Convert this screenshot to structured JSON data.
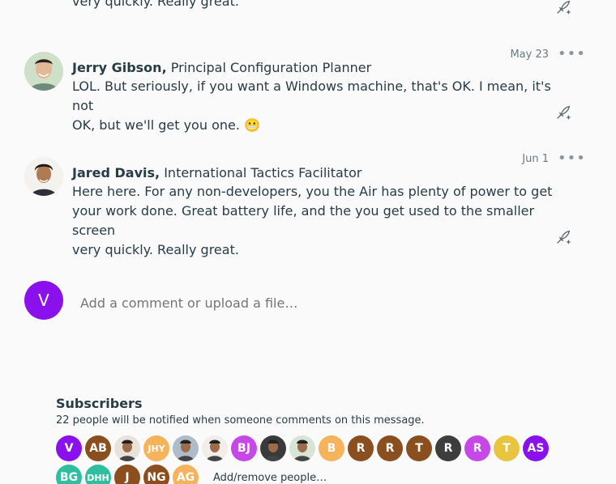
{
  "top_fragment": {
    "text": "very quickly. Really great."
  },
  "comments": [
    {
      "author": "Jerry Gibson,",
      "title": "Principal Configuration Planner",
      "date": "May 23",
      "text_line1": "LOL. But seriously, if you want a Windows machine, that's OK. I mean, it's not",
      "text_line2": "OK, but we'll get you one. 😬"
    },
    {
      "author": "Jared Davis,",
      "title": "International Tactics Facilitator",
      "date": "Jun 1",
      "text_line1": "Here here. For any non-developers, you the Air has plenty of power to get",
      "text_line2": "your work done. Great battery life, and the you get used to the smaller screen",
      "text_line3": "very quickly. Really great."
    }
  ],
  "more_glyph": "•••",
  "new_comment": {
    "avatar_initial": "V",
    "placeholder": "Add a comment or upload a file…"
  },
  "subscribers": {
    "title": "Subscribers",
    "note": "22 people will be notified when someone comments on this message.",
    "row1": [
      {
        "initials": "V",
        "color": "#8b11ec"
      },
      {
        "initials": "AB",
        "color": "#8b4f1f"
      },
      {
        "initials": "",
        "color": "#e9e2da",
        "photo": true
      },
      {
        "initials": "JHY",
        "color": "#f6b35c"
      },
      {
        "initials": "",
        "color": "#aebbc8",
        "photo": true
      },
      {
        "initials": "",
        "color": "#f2ede8",
        "photo": true
      },
      {
        "initials": "BJ",
        "color": "#c648e6"
      },
      {
        "initials": "",
        "color": "#3a3a3a",
        "photo": true
      },
      {
        "initials": "",
        "color": "#d8e4d6",
        "photo": true
      },
      {
        "initials": "B",
        "color": "#f6b35c"
      },
      {
        "initials": "R",
        "color": "#8b4f1f"
      },
      {
        "initials": "R",
        "color": "#8b4f1f"
      },
      {
        "initials": "T",
        "color": "#8b4f1f"
      },
      {
        "initials": "R",
        "color": "#3d3d3d"
      },
      {
        "initials": "R",
        "color": "#c648e6"
      },
      {
        "initials": "T",
        "color": "#e9c53f"
      },
      {
        "initials": "AS",
        "color": "#8b11ec"
      }
    ],
    "row2": [
      {
        "initials": "BG",
        "color": "#2fbfa0"
      },
      {
        "initials": "DHH",
        "color": "#2fbfa0"
      },
      {
        "initials": "J",
        "color": "#8b4f1f"
      },
      {
        "initials": "NG",
        "color": "#8b4f1f"
      },
      {
        "initials": "AG",
        "color": "#f6b35c"
      }
    ],
    "add_remove_label": "Add/remove people…"
  }
}
